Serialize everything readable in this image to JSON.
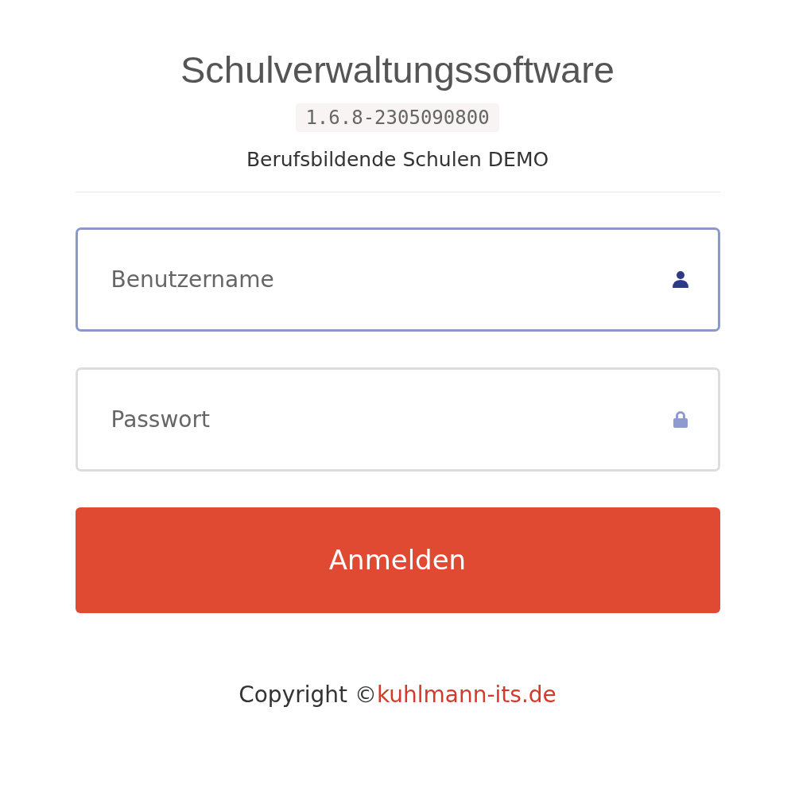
{
  "title": "Schulverwaltungssoftware",
  "version": "1.6.8-2305090800",
  "school": "Berufsbildende Schulen DEMO",
  "fields": [
    {
      "kind": "user",
      "placeholder": "Benutzername",
      "focused": true
    },
    {
      "kind": "password",
      "placeholder": "Passwort",
      "focused": false
    }
  ],
  "button": "Anmelden",
  "footer": {
    "text": "Copyright ©",
    "link": "kuhlmann-its.de"
  }
}
